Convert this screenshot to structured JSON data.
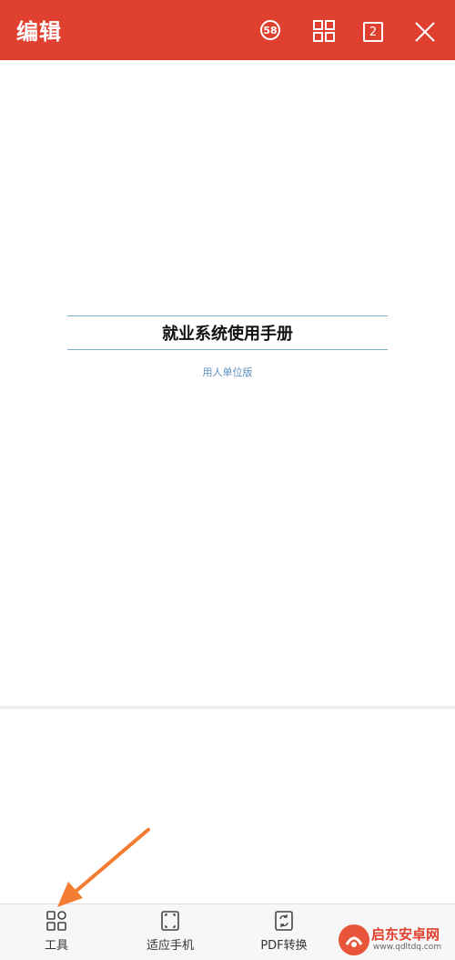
{
  "header": {
    "title": "编辑",
    "badge_count": "58",
    "page_count": "2",
    "bg_color": "#e0402f"
  },
  "document": {
    "title": "就业系统使用手册",
    "subtitle": "用人单位版"
  },
  "toolbar": {
    "items": [
      {
        "label": "工具",
        "icon": "tools-grid-icon"
      },
      {
        "label": "适应手机",
        "icon": "fit-screen-icon"
      },
      {
        "label": "PDF转换",
        "icon": "pdf-convert-icon"
      }
    ]
  },
  "annotation": {
    "arrow_color": "#f47c30"
  },
  "watermark": {
    "name": "启东安卓网",
    "url": "www.qdltdq.com"
  }
}
